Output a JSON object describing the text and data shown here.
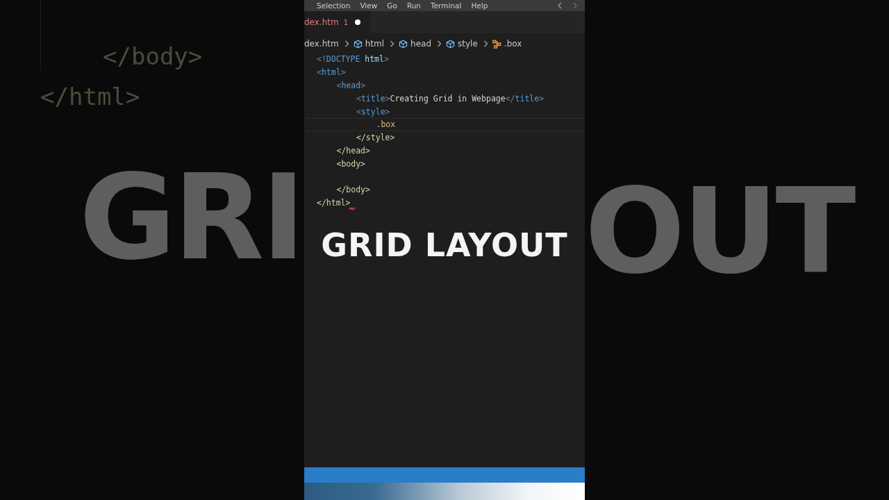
{
  "backdrop_left": {
    "code_lines": [
      "</body>",
      "</html>"
    ],
    "heading": "GRI"
  },
  "backdrop_right": {
    "heading": "OUT"
  },
  "editor": {
    "menu": [
      "Selection",
      "View",
      "Go",
      "Run",
      "Terminal",
      "Help"
    ],
    "tab": {
      "label": "dex.htm",
      "problems": "1",
      "modified": true
    },
    "breadcrumbs": [
      {
        "kind": "file",
        "label": "dex.htm"
      },
      {
        "kind": "element",
        "label": "html"
      },
      {
        "kind": "element",
        "label": "head"
      },
      {
        "kind": "element",
        "label": "style"
      },
      {
        "kind": "selector",
        "label": ".box"
      }
    ],
    "lines": [
      {
        "kind": "code",
        "current": false,
        "error": false,
        "tokens": [
          {
            "kind": "punct",
            "text": "<!"
          },
          {
            "kind": "tag",
            "text": "DOCTYPE"
          },
          {
            "kind": "attr",
            "text": "html"
          },
          {
            "kind": "punct",
            "text": ">"
          }
        ]
      },
      {
        "kind": "code",
        "current": false,
        "error": false,
        "tokens": [
          {
            "kind": "punct",
            "text": "<"
          },
          {
            "kind": "tag",
            "text": "html"
          },
          {
            "kind": "punct",
            "text": ">"
          }
        ],
        "children": [
          {
            "kind": "code",
            "current": false,
            "error": false,
            "tokens": [
              {
                "kind": "punct",
                "text": "<"
              },
              {
                "kind": "tag",
                "text": "head"
              },
              {
                "kind": "punct",
                "text": ">"
              }
            ],
            "children": [
              {
                "kind": "code",
                "current": false,
                "error": false,
                "tokens": [
                  {
                    "kind": "punct",
                    "text": "<"
                  },
                  {
                    "kind": "tag",
                    "text": "title"
                  },
                  {
                    "kind": "punct",
                    "text": ">"
                  },
                  {
                    "kind": "plain",
                    "text": "Creating Grid in Webpage"
                  },
                  {
                    "kind": "punct",
                    "text": "</"
                  },
                  {
                    "kind": "tag",
                    "text": "title"
                  },
                  {
                    "kind": "punct",
                    "text": ">"
                  }
                ]
              },
              {
                "kind": "code",
                "current": false,
                "error": false,
                "tokens": [
                  {
                    "kind": "punct",
                    "text": "<"
                  },
                  {
                    "kind": "tag",
                    "text": "style"
                  },
                  {
                    "kind": "punct",
                    "text": ">"
                  }
                ],
                "children": [
                  {
                    "kind": "code",
                    "current": true,
                    "error": false,
                    "tokens": [
                      {
                        "kind": "selector",
                        "text": ".box"
                      }
                    ]
                  }
                ]
              },
              {
                "kind": "code",
                "current": false,
                "error": false,
                "tokens": [
                  {
                    "kind": "match",
                    "text": "</style>"
                  }
                ]
              }
            ]
          },
          {
            "kind": "code",
            "current": false,
            "error": false,
            "tokens": [
              {
                "kind": "match",
                "text": "</head>"
              }
            ]
          },
          {
            "kind": "code",
            "current": false,
            "error": false,
            "tokens": [
              {
                "kind": "match",
                "text": "<body>"
              }
            ],
            "children": [
              {
                "kind": "blank"
              }
            ]
          },
          {
            "kind": "code",
            "current": false,
            "error": false,
            "tokens": [
              {
                "kind": "match",
                "text": "</body>"
              }
            ]
          }
        ]
      },
      {
        "kind": "code",
        "current": false,
        "error": true,
        "tokens": [
          {
            "kind": "match",
            "text": "</html>"
          }
        ]
      }
    ],
    "overlay_title": "GRID LAYOUT"
  }
}
